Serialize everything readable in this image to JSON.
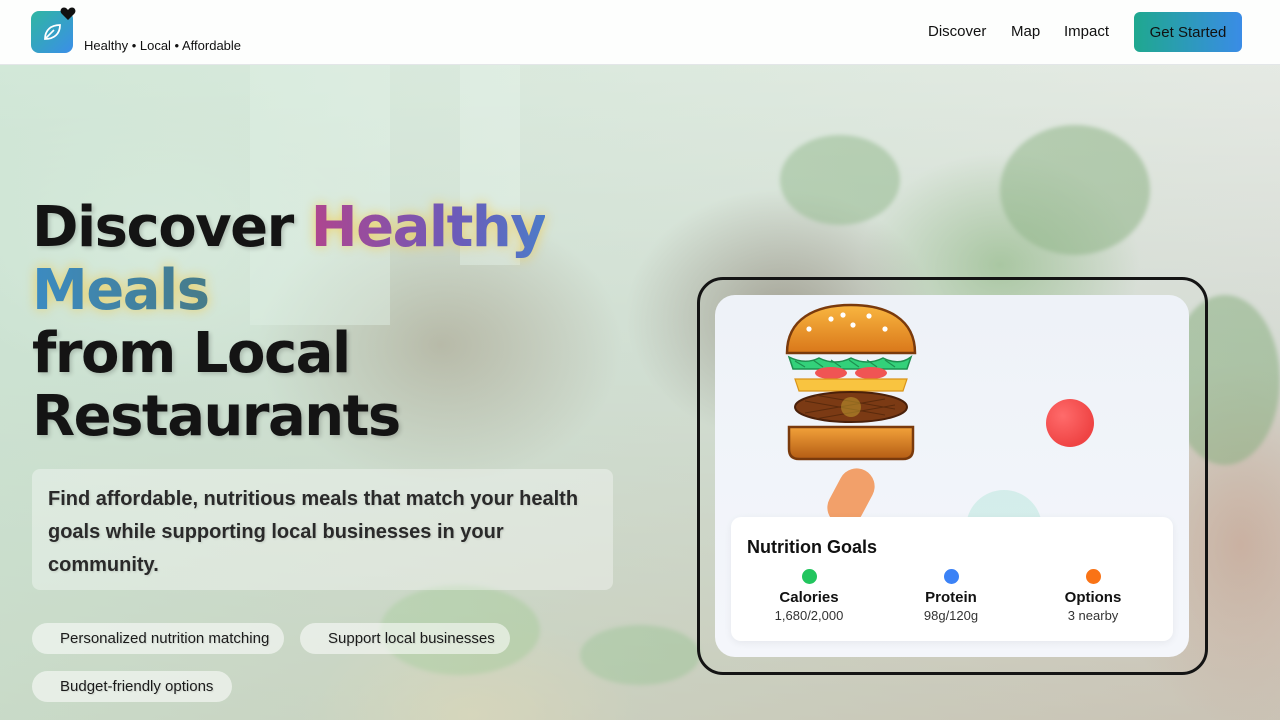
{
  "header": {
    "tagline": "Healthy • Local • Affordable",
    "nav": [
      "Discover",
      "Map",
      "Impact"
    ],
    "cta_label": "Get Started"
  },
  "hero": {
    "headline_part1": "Discover ",
    "headline_highlight1": "Healthy",
    "headline_highlight2": "Meals",
    "headline_part2": "from Local",
    "headline_part3": "Restaurants",
    "description": "Find affordable, nutritious meals that match your health goals while supporting local businesses in your community.",
    "features": [
      "Personalized nutrition matching",
      "Support local businesses",
      "Budget-friendly options"
    ]
  },
  "card": {
    "title": "Nutrition Goals",
    "metrics": [
      {
        "label": "Calories",
        "value": "1,680/2,000",
        "color": "#22c55e"
      },
      {
        "label": "Protein",
        "value": "98g/120g",
        "color": "#3b82f6"
      },
      {
        "label": "Options",
        "value": "3 nearby",
        "color": "#f97316"
      }
    ]
  },
  "colors": {
    "brand_start": "#2fb6a2",
    "brand_end": "#3b8ee8"
  }
}
